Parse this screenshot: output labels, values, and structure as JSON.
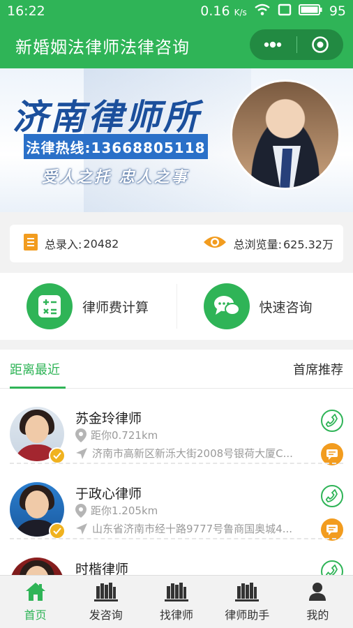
{
  "status": {
    "time": "16:22",
    "speed": "0.16",
    "speed_unit": "K/s",
    "battery": "95"
  },
  "header": {
    "title": "新婚姻法律师法律咨询"
  },
  "banner": {
    "firm": "济南律师所",
    "hotline": "法律热线:13668805118",
    "slogan": "受人之托 忠人之事",
    "dots_total": 9,
    "dots_active_index": 3
  },
  "stats": {
    "total_entries_label": "总录入:",
    "total_entries_value": "20482",
    "total_views_label": "总浏览量:",
    "total_views_value": "625.32万"
  },
  "quick_actions": [
    {
      "label": "律师费计算",
      "icon": "calculator-icon"
    },
    {
      "label": "快速咨询",
      "icon": "chat-bubbles-icon"
    }
  ],
  "tabs": {
    "nearest": "距离最近",
    "recommended": "首席推荐"
  },
  "lawyers": [
    {
      "name": "苏金玲律师",
      "distance": "距你0.721km",
      "address": "济南市高新区新泺大街2008号银荷大厦C..."
    },
    {
      "name": "于政心律师",
      "distance": "距你1.205km",
      "address": "山东省济南市经十路9777号鲁商国奥城4..."
    },
    {
      "name": "时楷律师",
      "distance": "",
      "address": ""
    }
  ],
  "tabbar": [
    {
      "label": "首页",
      "icon": "home-icon",
      "active": true
    },
    {
      "label": "发咨询",
      "icon": "books-icon",
      "active": false
    },
    {
      "label": "找律师",
      "icon": "books-icon",
      "active": false
    },
    {
      "label": "律师助手",
      "icon": "books-icon",
      "active": false
    },
    {
      "label": "我的",
      "icon": "person-icon",
      "active": false
    }
  ],
  "colors": {
    "brand_green": "#2fb457",
    "accent_orange": "#f29c1f",
    "banner_blue": "#1b4f9c"
  }
}
